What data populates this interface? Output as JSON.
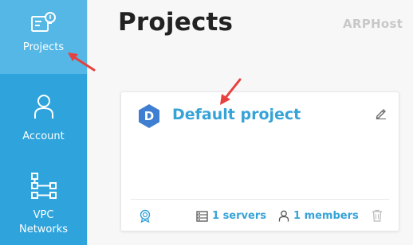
{
  "sidebar": {
    "items": [
      {
        "label": "Projects",
        "icon": "projects-icon"
      },
      {
        "label": "Account",
        "icon": "account-icon"
      },
      {
        "label": "VPC\nNetworks",
        "icon": "vpc-networks-icon"
      }
    ]
  },
  "header": {
    "title": "Projects",
    "brand": "ARPHost"
  },
  "project_card": {
    "avatar_letter": "D",
    "title": "Default project",
    "servers_label": "1 servers",
    "members_label": "1 members"
  },
  "colors": {
    "sidebar": "#2ea3dc",
    "sidebar_active": "#54b7e6",
    "accent": "#36a3d7",
    "annotation_arrow": "#e8403e"
  }
}
